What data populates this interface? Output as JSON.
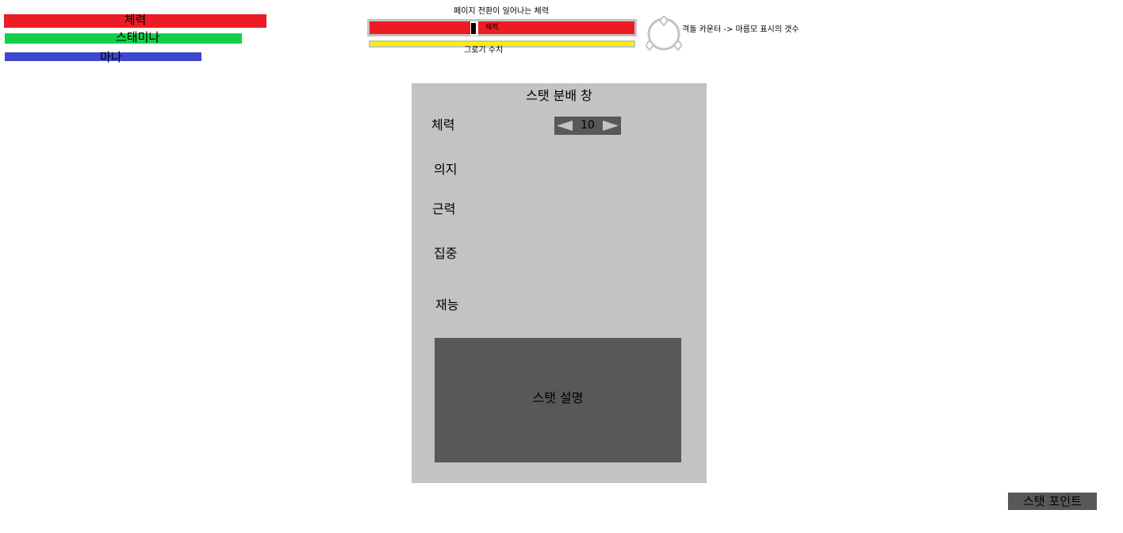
{
  "player_bars": {
    "hp_label": "체력",
    "stamina_label": "스태미나",
    "mana_label": "마나",
    "colors": {
      "hp": "#ed1c24",
      "stamina": "#14d048",
      "mana": "#3f48cc"
    }
  },
  "enemy_hud": {
    "page_transition_caption": "페이지 전환이 일어나는 체력",
    "hp_label": "체력",
    "groggy_caption": "그로기 수치",
    "parry_counter_caption": "격돌 카운터 -> 마름모 표시의 갯수",
    "colors": {
      "hp": "#ed1c24",
      "groggy": "#fff200",
      "frame": "#c3c3c3"
    }
  },
  "stat_window": {
    "title": "스탯 분배 창",
    "stats": [
      {
        "label": "체력",
        "value": "10"
      },
      {
        "label": "의지"
      },
      {
        "label": "근력"
      },
      {
        "label": "집중"
      },
      {
        "label": "재능"
      }
    ],
    "description": "스탯 설명"
  },
  "stat_point_button": {
    "label": "스탯 포인트"
  },
  "icons": {
    "decrease": "left-triangle-icon",
    "increase": "right-triangle-icon",
    "parry_counter": "diamond-counter-icon"
  }
}
